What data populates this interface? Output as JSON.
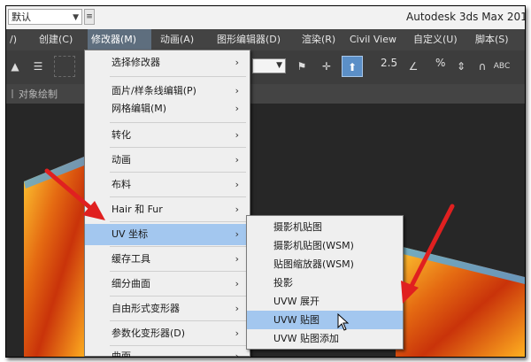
{
  "titlebar": {
    "workspace": "默认",
    "app_title": "Autodesk 3ds Max 201"
  },
  "menubar": {
    "items": [
      "/)",
      "创建(C)",
      "修改器(M)",
      "动画(A)",
      "图形编辑器(D)",
      "渲染(R)",
      "Civil View",
      "自定义(U)",
      "脚本(S)"
    ]
  },
  "toolbar": {
    "angle_snap": "2.5",
    "percent_snap": "%",
    "abc": "ABC"
  },
  "ribbon": {
    "label": "对象绘制"
  },
  "modifiers_menu": {
    "items": [
      {
        "label": "选择修改器",
        "arrow": "›"
      },
      {
        "label": "面片/样条线编辑(P)",
        "arrow": "›"
      },
      {
        "label": "网格编辑(M)",
        "arrow": "›"
      },
      {
        "label": "转化",
        "arrow": "›"
      },
      {
        "label": "动画",
        "arrow": "›"
      },
      {
        "label": "布料",
        "arrow": "›"
      },
      {
        "label": "Hair 和 Fur",
        "arrow": "›"
      },
      {
        "label": "UV 坐标",
        "arrow": "›"
      },
      {
        "label": "缓存工具",
        "arrow": "›"
      },
      {
        "label": "细分曲面",
        "arrow": "›"
      },
      {
        "label": "自由形式变形器",
        "arrow": "›"
      },
      {
        "label": "参数化变形器(D)",
        "arrow": "›"
      },
      {
        "label": "曲面",
        "arrow": "›"
      }
    ]
  },
  "uv_submenu": {
    "items": [
      "摄影机贴图",
      "摄影机贴图(WSM)",
      "贴图缩放器(WSM)",
      "投影",
      "UVW 展开",
      "UVW 贴图",
      "UVW 贴图添加"
    ]
  },
  "colors": {
    "menu_highlight": "#a3c7ef",
    "annotation_arrow": "#e02020",
    "active_menu": "#5e6e7e"
  }
}
